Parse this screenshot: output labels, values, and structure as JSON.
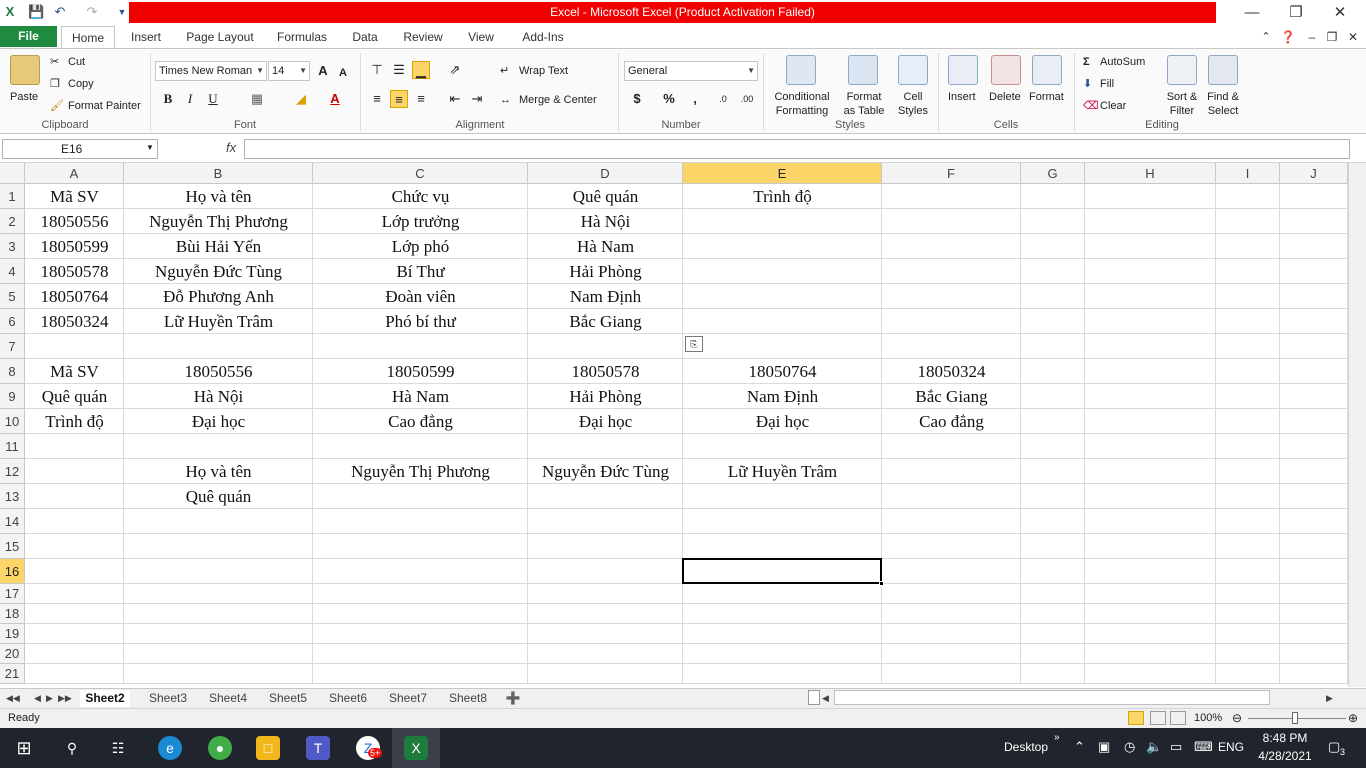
{
  "window": {
    "title": "Excel  -  Microsoft Excel (Product Activation Failed)",
    "title_bar_color": "#f00000"
  },
  "ribbon_tabs": [
    "File",
    "Home",
    "Insert",
    "Page Layout",
    "Formulas",
    "Data",
    "Review",
    "View",
    "Add-Ins"
  ],
  "clipboard": {
    "paste": "Paste",
    "cut": "Cut",
    "copy": "Copy",
    "format_painter": "Format Painter",
    "label": "Clipboard"
  },
  "font": {
    "name": "Times New Roman",
    "size": "14",
    "bold": "B",
    "italic": "I",
    "underline": "U",
    "label": "Font"
  },
  "alignment": {
    "wrap_text": "Wrap Text",
    "merge_center": "Merge & Center",
    "label": "Alignment"
  },
  "number": {
    "format": "General",
    "label": "Number",
    "currency": "$",
    "percent": "%",
    "comma": ","
  },
  "styles": {
    "conditional": [
      "Conditional",
      "Formatting"
    ],
    "format_table": [
      "Format",
      "as Table"
    ],
    "cell_styles": [
      "Cell",
      "Styles"
    ],
    "label": "Styles"
  },
  "cells": {
    "insert": "Insert",
    "delete": "Delete",
    "format": "Format",
    "label": "Cells"
  },
  "editing": {
    "autosum": "AutoSum",
    "fill": "Fill",
    "clear": "Clear",
    "sort_filter": [
      "Sort &",
      "Filter"
    ],
    "find_select": [
      "Find &",
      "Select"
    ],
    "label": "Editing"
  },
  "formula_bar": {
    "name_box": "E16",
    "fx": "fx",
    "content": ""
  },
  "columns": [
    "A",
    "B",
    "C",
    "D",
    "E",
    "F",
    "G",
    "H",
    "I",
    "J"
  ],
  "rows": [
    "1",
    "2",
    "3",
    "4",
    "5",
    "6",
    "7",
    "8",
    "9",
    "10",
    "11",
    "12",
    "13",
    "14",
    "15",
    "16",
    "17",
    "18",
    "19",
    "20",
    "21"
  ],
  "selected": {
    "column": "E",
    "row": "16"
  },
  "cells_data": {
    "r1": [
      "Mã SV",
      "Họ và tên",
      "Chức vụ",
      "Quê quán",
      "Trình độ"
    ],
    "r2": [
      "18050556",
      "Nguyễn Thị Phương",
      "Lớp trưởng",
      "Hà Nội"
    ],
    "r3": [
      "18050599",
      "Bùi Hải Yến",
      "Lớp phó",
      "Hà Nam"
    ],
    "r4": [
      "18050578",
      "Nguyễn Đức Tùng",
      "Bí Thư",
      "Hải Phòng"
    ],
    "r5": [
      "18050764",
      "Đỗ Phương Anh",
      "Đoàn viên",
      "Nam Định"
    ],
    "r6": [
      "18050324",
      "Lữ Huyền Trâm",
      "Phó bí thư",
      "Bắc Giang"
    ],
    "r8": [
      "Mã SV",
      "18050556",
      "18050599",
      "18050578",
      "18050764",
      "18050324"
    ],
    "r9": [
      "Quê quán",
      "Hà Nội",
      "Hà Nam",
      "Hải Phòng",
      "Nam Định",
      "Bắc Giang"
    ],
    "r10": [
      "Trình độ",
      "Đại học",
      "Cao đẳng",
      "Đại học",
      "Đại học",
      "Cao đẳng"
    ],
    "r12": [
      "Họ và tên",
      "Nguyễn Thị Phương",
      "Nguyễn Đức Tùng",
      "Lữ Huyền Trâm"
    ],
    "r13": [
      "Quê quán"
    ]
  },
  "sheets": [
    "Sheet2",
    "Sheet3",
    "Sheet4",
    "Sheet5",
    "Sheet6",
    "Sheet7",
    "Sheet8"
  ],
  "active_sheet": "Sheet2",
  "status": {
    "ready": "Ready",
    "zoom": "100%"
  },
  "taskbar": {
    "desktop": "Desktop",
    "lang": "ENG",
    "time": "8:48 PM",
    "date": "4/28/2021",
    "notifications": "3",
    "zalo_badge": "5+"
  }
}
